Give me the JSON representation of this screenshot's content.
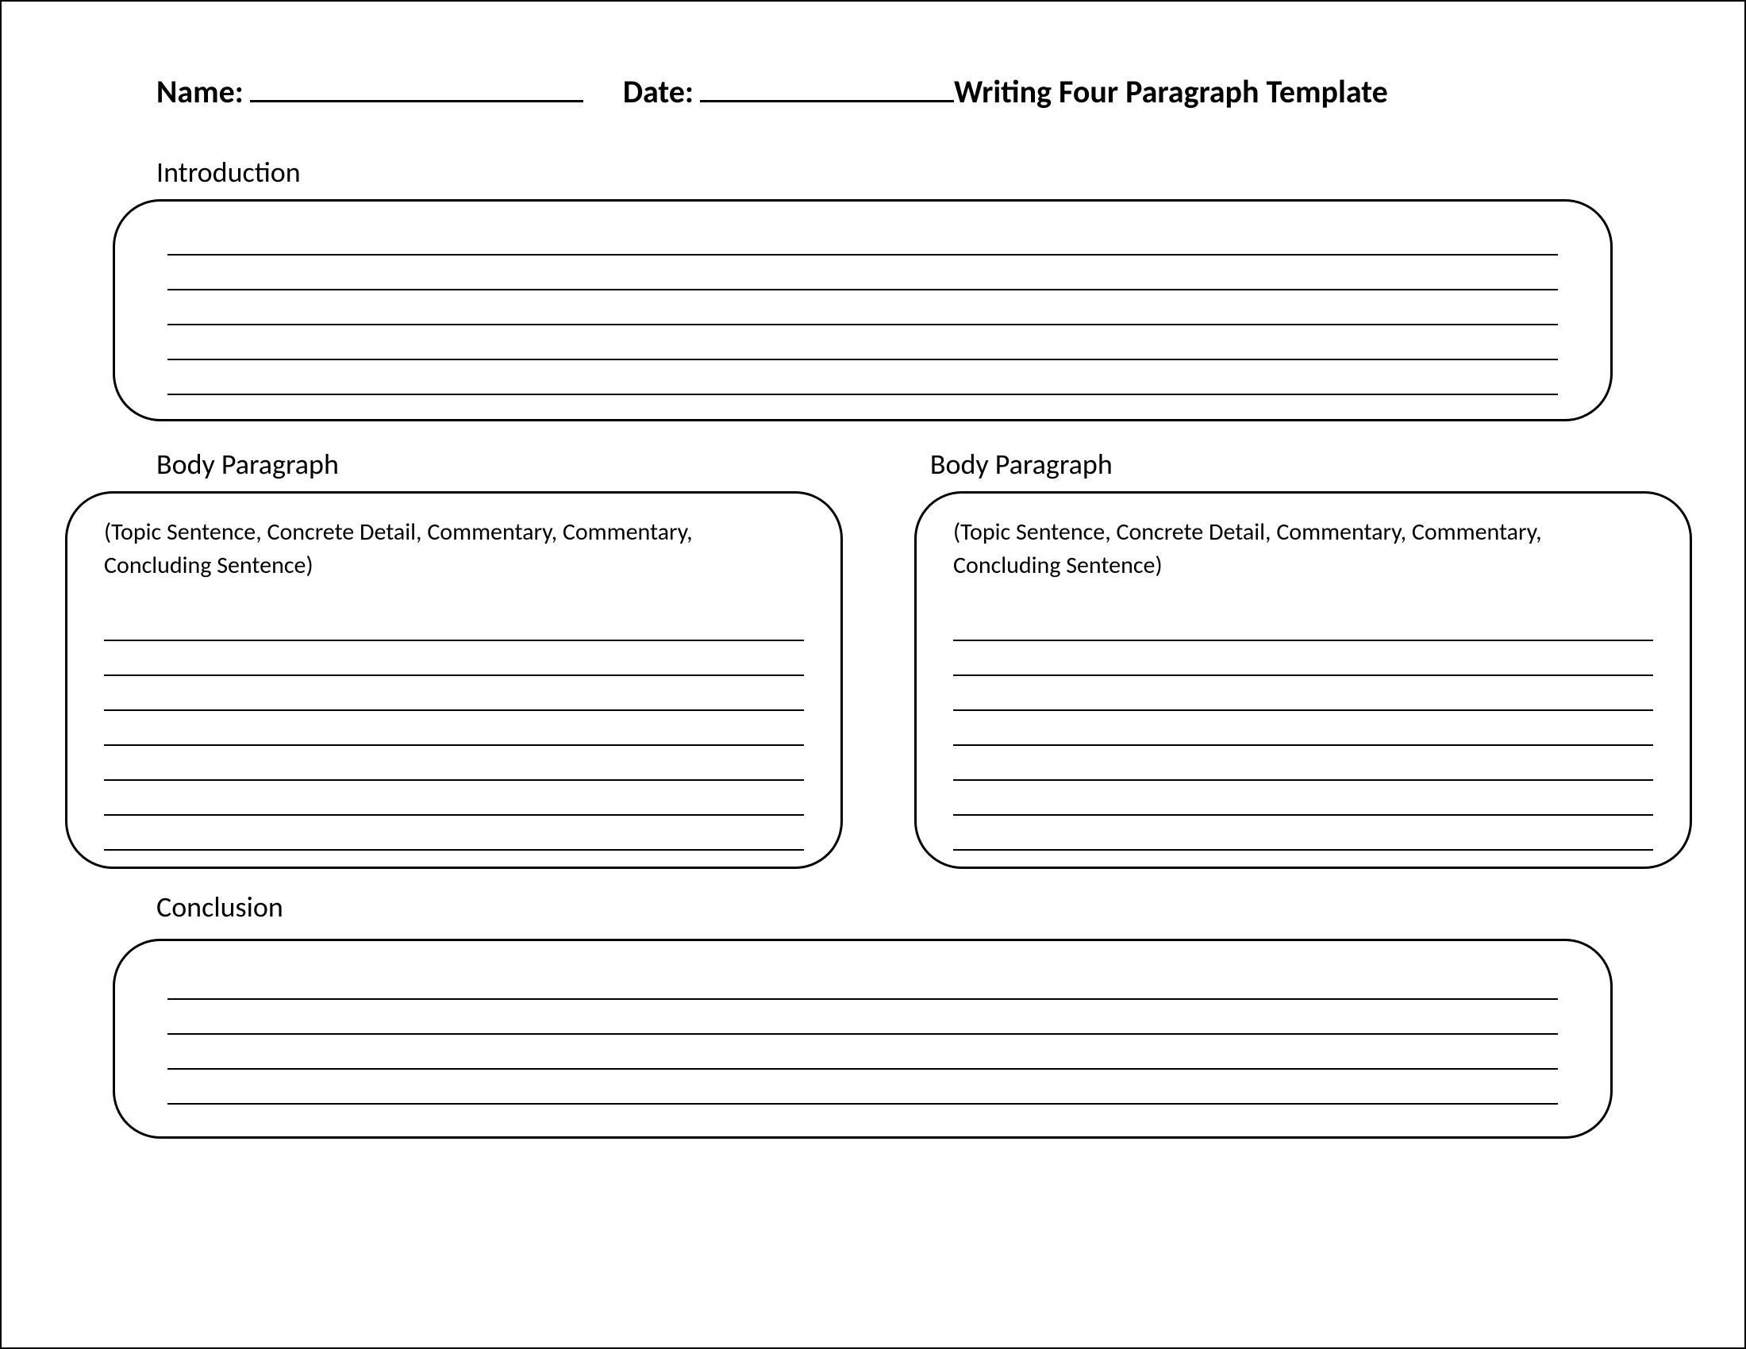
{
  "header": {
    "name_label": "Name:",
    "date_label": "Date:",
    "title": "Writing Four Paragraph Template"
  },
  "sections": {
    "introduction_label": "Introduction",
    "body1_label": "Body Paragraph",
    "body2_label": "Body Paragraph",
    "conclusion_label": "Conclusion",
    "body_hint": "(Topic Sentence, Concrete Detail, Commentary, Commentary, Concluding Sentence)"
  }
}
